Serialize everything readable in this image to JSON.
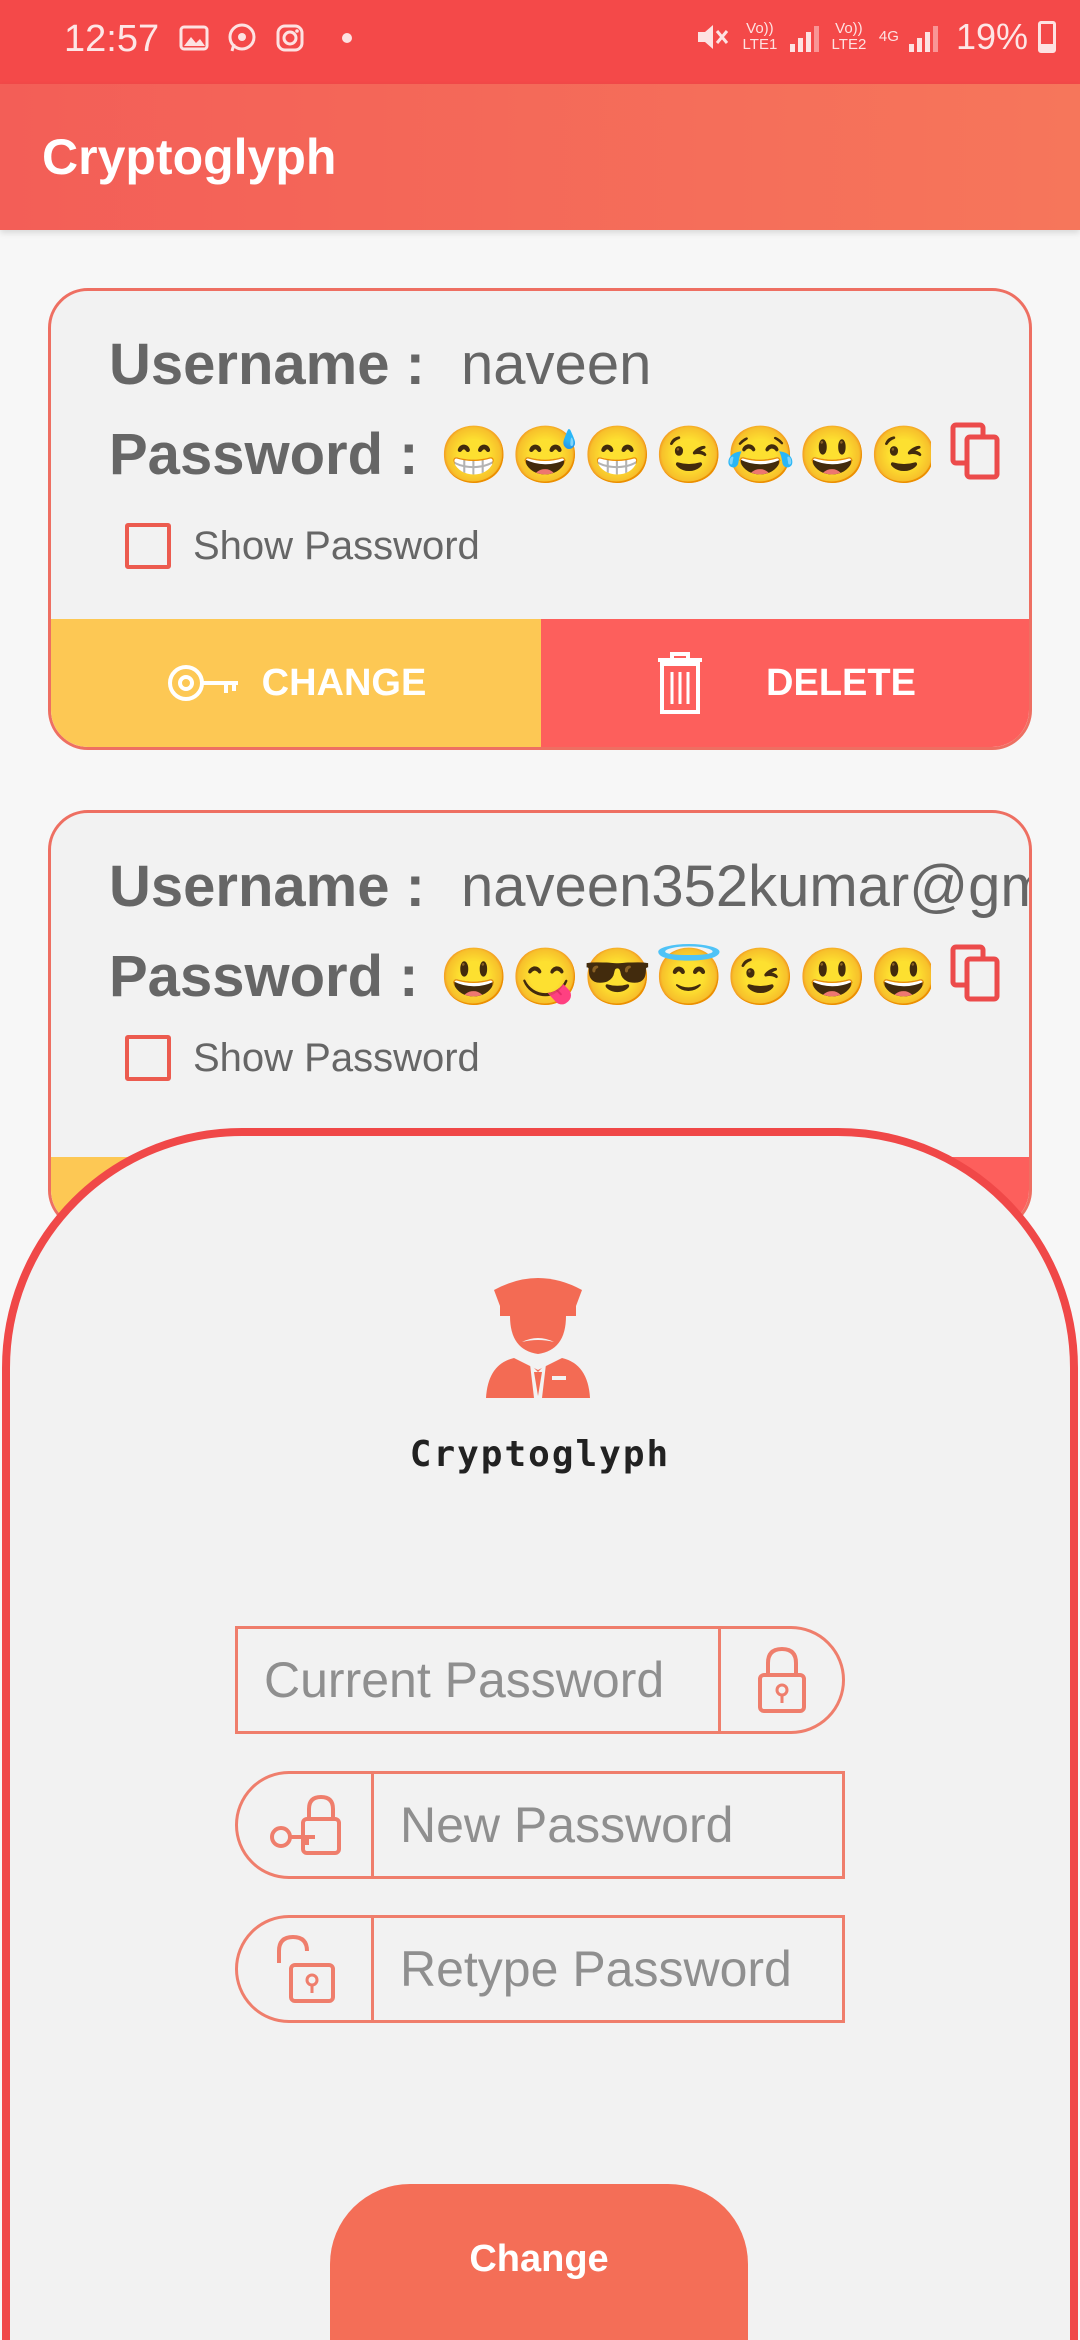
{
  "status_bar": {
    "time": "12:57",
    "sim1_label": "Vo)) LTE1",
    "sim2_label": "Vo)) LTE2",
    "network": "4G",
    "battery": "19%"
  },
  "app_bar": {
    "title": "Cryptoglyph"
  },
  "accounts": [
    {
      "username_label": "Username :",
      "username": "naveen",
      "password_label": "Password   :",
      "password_emoji": "😁😅😁😉😂😃😉😁",
      "show_password_label": "Show Password",
      "change_label": "CHANGE",
      "delete_label": "DELETE"
    },
    {
      "username_label": "Username :",
      "username": "naveen352kumar@gm",
      "password_label": "Password   :",
      "password_emoji": "😃😋😎😇😉😃😃😘",
      "show_password_label": "Show Password"
    }
  ],
  "sheet": {
    "logo_icon": "guard-avatar-icon",
    "title": "Cryptoglyph",
    "current_placeholder": "Current Password",
    "new_placeholder": "New Password",
    "retype_placeholder": "Retype Password",
    "change_button": "Change"
  },
  "colors": {
    "accent": "#f46e57",
    "status_bar": "#f44949",
    "change_yellow": "#fdc854",
    "delete_red": "#fd5f5c"
  }
}
